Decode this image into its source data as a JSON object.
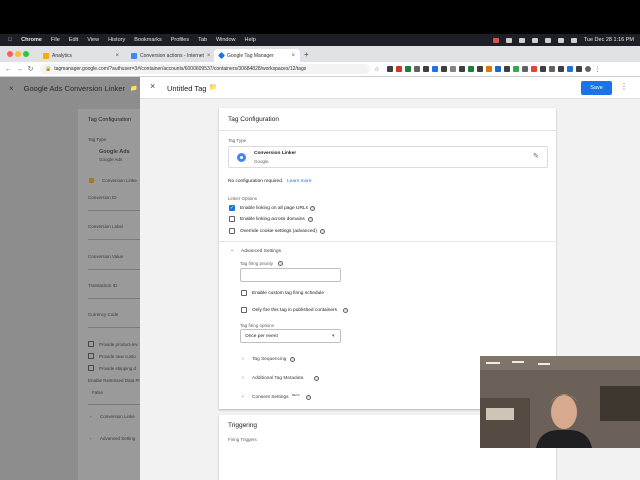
{
  "menubar": {
    "items": [
      "Chrome",
      "File",
      "Edit",
      "View",
      "History",
      "Bookmarks",
      "Profiles",
      "Tab",
      "Window",
      "Help"
    ],
    "datetime": "Tue Dec 28  1:16 PM"
  },
  "browser": {
    "tabs": [
      {
        "label": "Analytics"
      },
      {
        "label": "Conversion actions - Internet"
      },
      {
        "label": "Google Tag Manager"
      }
    ],
    "new_tab": "+",
    "url": "tagmanager.google.com/?authuser=3#/container/accounts/6000609537/containers/30684828/workspaces/12/tags"
  },
  "background": {
    "title": "Google Ads Conversion Linker",
    "card_title": "Tag Configuration",
    "tag_type_label": "Tag Type",
    "tag_name": "Google Ads",
    "tag_sub": "Google Ads",
    "warning": "Conversion Linke",
    "fields": [
      "Conversion ID",
      "Conversion Label",
      "Conversion Value",
      "Transaction ID",
      "Currency Code"
    ],
    "checks": [
      "Provide product-lev",
      "Provide new custo",
      "Provide shipping d"
    ],
    "restricted_label": "Enable Restricted Data Pr",
    "restricted_value": "False",
    "sections": [
      "Conversion Linke",
      "Advanced Setting"
    ]
  },
  "panel": {
    "title": "Untitled Tag",
    "save_label": "Save",
    "config": {
      "title": "Tag Configuration",
      "tag_type_label": "Tag Type",
      "tag_name": "Conversion Linker",
      "tag_vendor": "Google",
      "no_config_text": "No configuration required.",
      "learn_more": "Learn more",
      "linker_options_label": "Linker Options",
      "options": [
        {
          "label": "Enable linking on all page URLs",
          "checked": true
        },
        {
          "label": "Enable linking across domains",
          "checked": false
        },
        {
          "label": "Override cookie settings (advanced)",
          "checked": false
        }
      ],
      "advanced": {
        "title": "Advanced Settings",
        "priority_label": "Tag firing priority",
        "priority_value": "",
        "custom_schedule": "Enable custom tag firing schedule",
        "published_only": "Only fire this tag in published containers",
        "firing_options_label": "Tag firing options",
        "firing_option": "Once per event",
        "sections": [
          "Tag Sequencing",
          "Additional Tag Metadata",
          "Consent Settings"
        ],
        "beta": "BETA"
      }
    },
    "triggering": {
      "title": "Triggering",
      "firing_label": "Firing Triggers"
    }
  },
  "colors": {
    "accent": "#1a73e8",
    "warning": "#f9ab00",
    "overlay": "#8d8d8d"
  }
}
